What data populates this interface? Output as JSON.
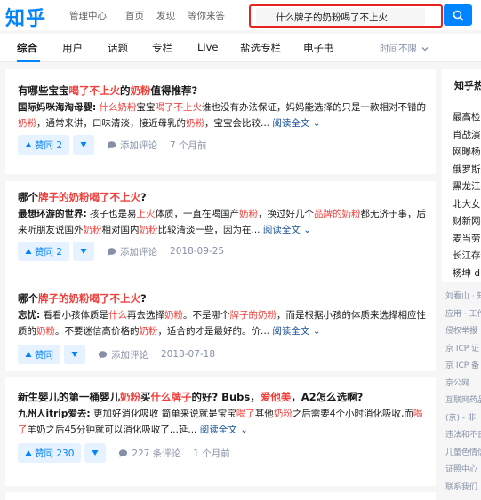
{
  "header": {
    "logo": "知乎",
    "nav": [
      "管理中心",
      "首页",
      "发现",
      "等你来答"
    ],
    "search_value": "什么牌子的奶粉喝了不上火"
  },
  "tabs": {
    "items": [
      "综合",
      "用户",
      "话题",
      "专栏",
      "Live",
      "盐选专栏",
      "电子书"
    ],
    "time_filter": "时间不限"
  },
  "results": [
    {
      "title_parts": [
        {
          "t": "有哪些宝宝",
          "hl": false
        },
        {
          "t": "喝了不上火",
          "hl": true
        },
        {
          "t": "的",
          "hl": false
        },
        {
          "t": "奶粉",
          "hl": true
        },
        {
          "t": "值得推荐?",
          "hl": false
        }
      ],
      "author": "国际妈咪海淘母婴:",
      "excerpt_parts": [
        {
          "t": " ",
          "hl": false
        },
        {
          "t": "什么奶粉",
          "hl": true
        },
        {
          "t": "宝宝",
          "hl": false
        },
        {
          "t": "喝了不上火",
          "hl": true
        },
        {
          "t": "谁也没有办法保证，妈妈能选择的只是一款相对不错的",
          "hl": false
        },
        {
          "t": "奶粉",
          "hl": true
        },
        {
          "t": "，通常来讲，口味清淡，接近母乳的",
          "hl": false
        },
        {
          "t": "奶粉",
          "hl": true
        },
        {
          "t": "，宝宝会比较...",
          "hl": false
        }
      ],
      "read_more": "阅读全文",
      "votes": "赞同 2",
      "comment": "添加评论",
      "time": "7 个月前"
    },
    {
      "title_parts": [
        {
          "t": "哪个",
          "hl": false
        },
        {
          "t": "牌子的奶粉喝了不上火",
          "hl": true
        },
        {
          "t": "?",
          "hl": false
        }
      ],
      "author": "最想环游的世界:",
      "excerpt_parts": [
        {
          "t": " 孩子也是易",
          "hl": false
        },
        {
          "t": "上火",
          "hl": true
        },
        {
          "t": "体质，一直在喝国产",
          "hl": false
        },
        {
          "t": "奶粉",
          "hl": true
        },
        {
          "t": "，换过好几个",
          "hl": false
        },
        {
          "t": "品牌的奶粉",
          "hl": true
        },
        {
          "t": "都无济于事，后来听朋友说国外",
          "hl": false
        },
        {
          "t": "奶粉",
          "hl": true
        },
        {
          "t": "相对国内",
          "hl": false
        },
        {
          "t": "奶粉",
          "hl": true
        },
        {
          "t": "比较清淡一些，因为在...",
          "hl": false
        }
      ],
      "read_more": "阅读全文",
      "votes": "赞同 2",
      "comment": "添加评论",
      "time": "2018-09-25"
    },
    {
      "title_parts": [
        {
          "t": "哪个",
          "hl": false
        },
        {
          "t": "牌子的奶粉喝了不上火",
          "hl": true
        },
        {
          "t": "?",
          "hl": false
        }
      ],
      "author": "忘忧:",
      "excerpt_parts": [
        {
          "t": " 看看小孩体质是",
          "hl": false
        },
        {
          "t": "什么",
          "hl": true
        },
        {
          "t": "再去选择",
          "hl": false
        },
        {
          "t": "奶粉",
          "hl": true
        },
        {
          "t": "。不是哪个",
          "hl": false
        },
        {
          "t": "牌子的奶粉",
          "hl": true
        },
        {
          "t": "，而是根据小孩的体质来选择相应性质的",
          "hl": false
        },
        {
          "t": "奶粉",
          "hl": true
        },
        {
          "t": "。不要迷信高价格的",
          "hl": false
        },
        {
          "t": "奶粉",
          "hl": true
        },
        {
          "t": "，适合的才是最好的。价...",
          "hl": false
        }
      ],
      "read_more": "阅读全文",
      "votes": "赞同",
      "comment": "添加评论",
      "time": "2018-07-18"
    },
    {
      "title_parts": [
        {
          "t": "新生婴儿的第一桶婴儿",
          "hl": false
        },
        {
          "t": "奶粉",
          "hl": true
        },
        {
          "t": "买",
          "hl": false
        },
        {
          "t": "什么牌子",
          "hl": true
        },
        {
          "t": "的好? Bubs，",
          "hl": false
        },
        {
          "t": "爱他美",
          "hl": true
        },
        {
          "t": "，A2怎么选啊?",
          "hl": false
        }
      ],
      "author": "九州人itrip爱去:",
      "excerpt_parts": [
        {
          "t": " 更加好消化吸收 简单来说就是宝宝",
          "hl": false
        },
        {
          "t": "喝了",
          "hl": true
        },
        {
          "t": "其他",
          "hl": false
        },
        {
          "t": "奶粉",
          "hl": true
        },
        {
          "t": "之后需要4个小时消化吸收,而",
          "hl": false
        },
        {
          "t": "喝了",
          "hl": true
        },
        {
          "t": "羊奶之后45分钟就可以消化吸收了...延...",
          "hl": false
        }
      ],
      "read_more": "阅读全文",
      "votes": "赞同 230",
      "comment": "227 条评论",
      "time": "1 个月前"
    }
  ],
  "sidebar": {
    "title": "知乎热搜",
    "items": [
      "最高检立",
      "肖战演唱",
      "网曝杨幂",
      "俄罗斯航",
      "黑龙江鹤",
      "北大女生",
      "财新网报",
      "麦当劳",
      "长江存储",
      "杨坤 di"
    ]
  },
  "footer": {
    "items": [
      "刘看山 · 知",
      "应用 · 工作",
      "侵权举报",
      "京 ICP 证",
      "京 ICP 备",
      "京公网",
      "互联网药品",
      "(京) - 非",
      "违法和不良",
      "儿童色情信",
      "证照中心",
      "联系我们"
    ]
  }
}
